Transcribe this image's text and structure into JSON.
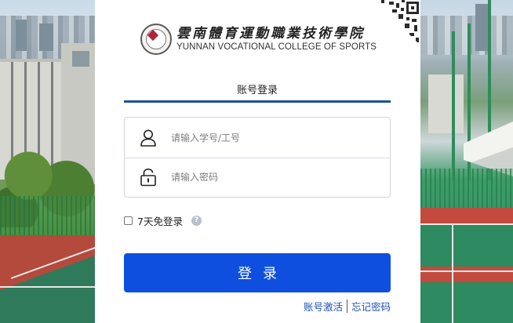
{
  "school": {
    "name_cn": "雲南體育運動職業技術學院",
    "name_en": "YUNNAN VOCATIONAL COLLEGE OF SPORTS"
  },
  "login": {
    "tab_label": "账号登录",
    "username_placeholder": "请输入学号/工号",
    "password_placeholder": "请输入密码",
    "remember_label": "7天免登录",
    "help_glyph": "?",
    "submit_label": "登录",
    "activate_link": "账号激活",
    "forgot_link": "忘记密码"
  },
  "colors": {
    "accent": "#0f4fe0",
    "tab_underline": "#1f4fa3",
    "link": "#1f4fb5"
  },
  "icons": {
    "username": "user-icon",
    "password": "lock-icon",
    "help": "help-icon",
    "qr": "qr-code-icon"
  }
}
